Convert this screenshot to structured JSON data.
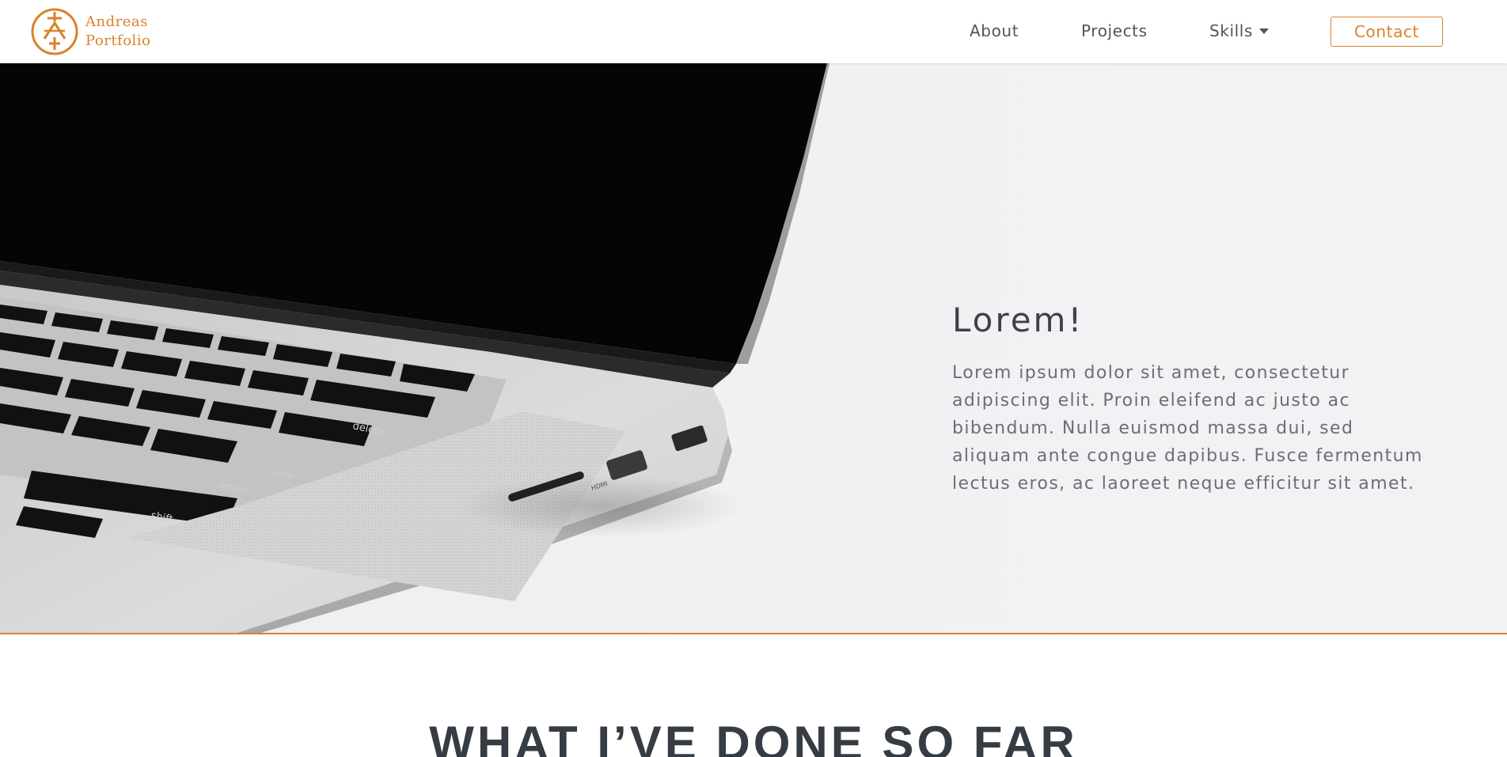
{
  "brand": {
    "line1": "Andreas",
    "line2": "Portfolio",
    "logo_icon": "compass-cross-logo-icon",
    "accent_color": "#d9822b"
  },
  "nav": {
    "about": "About",
    "projects": "Projects",
    "skills": "Skills",
    "skills_icon": "caret-down-icon",
    "contact": "Contact"
  },
  "hero": {
    "title": "Lorem!",
    "body": "Lorem ipsum dolor sit amet, consectetur adipiscing elit. Proin eleifend ac justo ac bibendum. Nulla euismod massa dui, sed aliquam ante congue dapibus. Fusce fermentum lectus eros, ac laoreet neque efficitur sit amet.",
    "image": "laptop-photo"
  },
  "section": {
    "title": "WHAT I’VE DONE SO FAR"
  }
}
